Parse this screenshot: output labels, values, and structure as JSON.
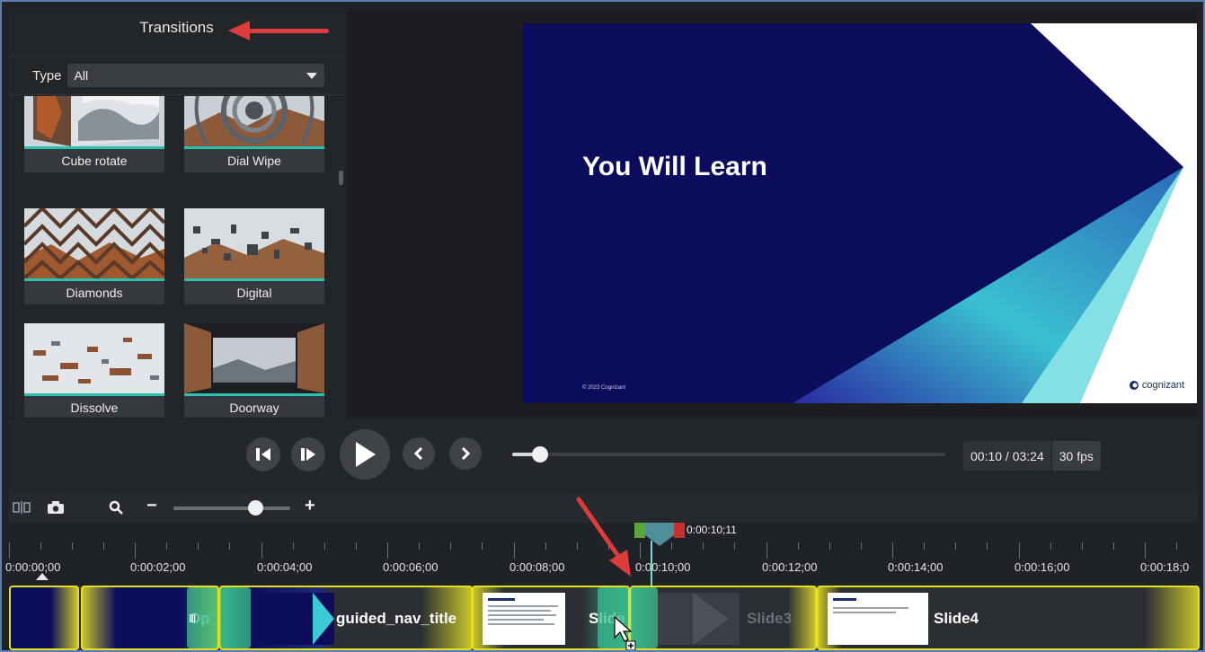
{
  "transitions_panel": {
    "title": "Transitions",
    "type_label": "Type",
    "type_value": "All",
    "items": [
      {
        "label": "Cube rotate",
        "icon": "cube-rotate-thumbnail"
      },
      {
        "label": "Dial Wipe",
        "icon": "dial-wipe-thumbnail"
      },
      {
        "label": "Diamonds",
        "icon": "diamonds-thumbnail"
      },
      {
        "label": "Digital",
        "icon": "digital-thumbnail"
      },
      {
        "label": "Dissolve",
        "icon": "dissolve-thumbnail"
      },
      {
        "label": "Doorway",
        "icon": "doorway-thumbnail"
      }
    ]
  },
  "preview": {
    "slide_title": "You Will Learn",
    "slide_copyright": "© 2023 Cognizant",
    "slide_logo": "cognizant"
  },
  "playback": {
    "time_display": "00:10 / 03:24",
    "fps": "30 fps",
    "progress_fraction": 0.05
  },
  "timeline": {
    "playhead_time": "0:00:10;11",
    "ruler_labels": [
      "0:00:00;00",
      "0:00:02;00",
      "0:00:04;00",
      "0:00:06;00",
      "0:00:08;00",
      "0:00:10;00",
      "0:00:12;00",
      "0:00:14;00",
      "0:00:16;00",
      "0:00:18;0"
    ],
    "zoom_minus": "−",
    "zoom_plus": "+",
    "clips": [
      {
        "label": "Op"
      },
      {
        "label": "guided_nav_title"
      },
      {
        "label": "Slide"
      },
      {
        "label": "Slide3"
      },
      {
        "label": "Slide4"
      }
    ]
  },
  "colors": {
    "accent_teal": "#29c2b0",
    "clip_border": "#e5e01f",
    "annotation_red": "#e03b3b",
    "slide_navy": "#0b0d5c"
  }
}
